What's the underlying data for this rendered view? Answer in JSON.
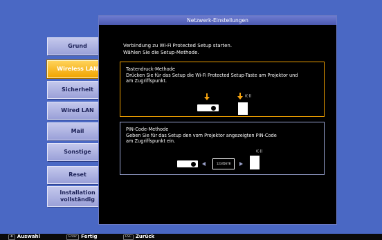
{
  "menu": {
    "items": [
      {
        "label": "Grund"
      },
      {
        "label": "Wireless LAN"
      },
      {
        "label": "Sicherheit"
      },
      {
        "label": "Wired LAN"
      },
      {
        "label": "Mail"
      },
      {
        "label": "Sonstige"
      },
      {
        "label": "Reset"
      },
      {
        "label": "Installation vollständig"
      }
    ],
    "active_index": 1
  },
  "panel": {
    "title": "Netzwerk-Einstellungen",
    "intro_line1": "Verbindung zu Wi-Fi Protected Setup starten.",
    "intro_line2": "Wählen Sie die Setup-Methode."
  },
  "push_method": {
    "title": "Tastendruck-Methode",
    "line1": "Drücken Sie für das Setup die Wi-Fi Protected Setup-Taste am Projektor und",
    "line2": "am Zugriffspunkt.",
    "wave_label": "((·))"
  },
  "pin_method": {
    "title": "PIN-Code-Methode",
    "line1": "Geben Sie für das Setup den vom Projektor angezeigten PIN-Code",
    "line2": "am Zugriffspunkt ein.",
    "pin_value": "12345678",
    "wave_label": "((·))"
  },
  "footer": {
    "select_label": "Auswahl",
    "enter_key": "Enter",
    "enter_label": "Fertig",
    "esc_key": "ESC",
    "esc_label": "Zurück"
  },
  "colors": {
    "background": "#4a68c4",
    "active_accent": "#f1a400",
    "panel": "#000000"
  },
  "icons": [
    "projector-icon",
    "access-point-icon",
    "arrow-down-icon",
    "arrow-left-icon",
    "arrow-right-icon",
    "select-cross-icon"
  ]
}
